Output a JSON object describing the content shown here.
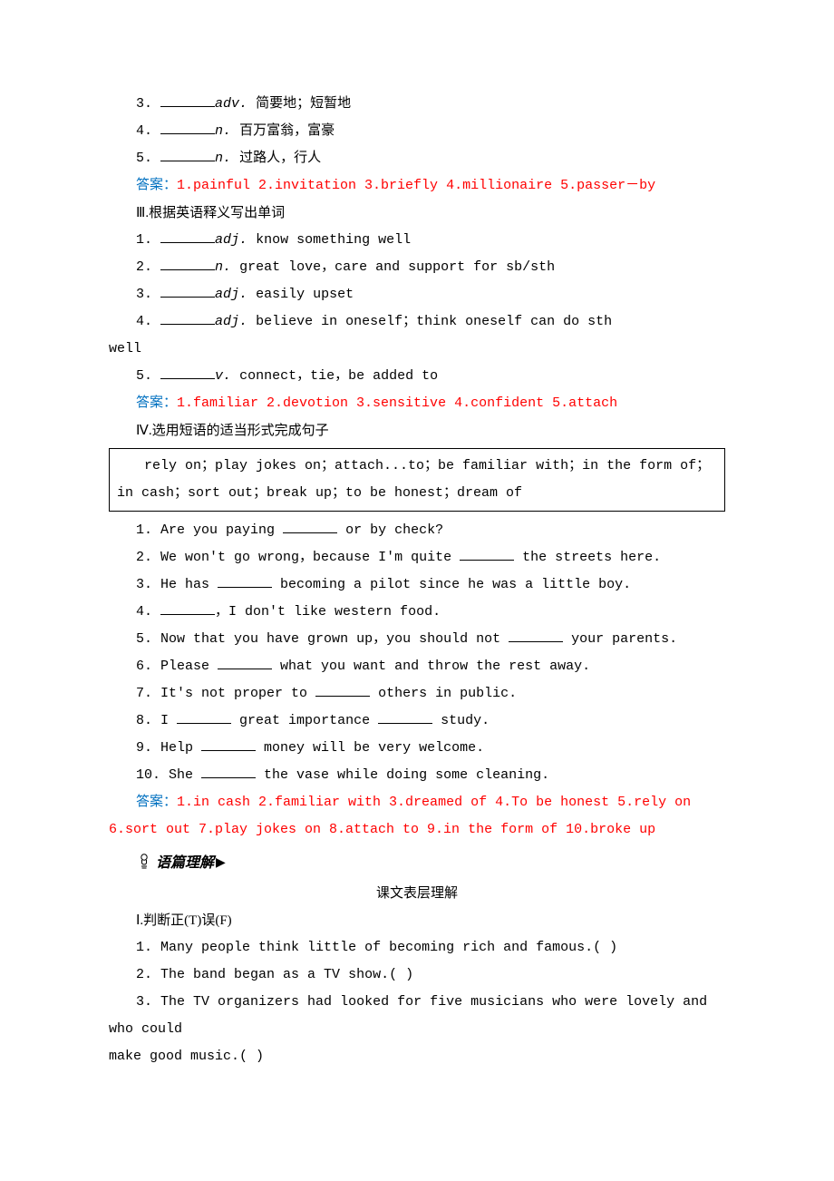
{
  "sec2": {
    "items": [
      {
        "num": "3.",
        "pos": "adv.",
        "def": "简要地；短暂地"
      },
      {
        "num": "4.",
        "pos": "n.",
        "def": "百万富翁，富豪"
      },
      {
        "num": "5.",
        "pos": "n.",
        "def": "过路人，行人"
      }
    ],
    "answer_label": "答案：",
    "answer": "1.painful  2.invitation  3.briefly  4.millionaire  5.passer－by"
  },
  "sec3": {
    "heading": "Ⅲ.根据英语释义写出单词",
    "items": [
      {
        "num": "1.",
        "pos": "adj.",
        "def": "know something well"
      },
      {
        "num": "2.",
        "pos": "n.",
        "def": "great love，care and support for sb/sth"
      },
      {
        "num": "3.",
        "pos": "adj.",
        "def": "easily upset"
      },
      {
        "num": "4.",
        "pos": "adj.",
        "def": "believe in oneself；think oneself can do sth"
      },
      {
        "num": "5.",
        "pos": "v.",
        "def": "connect，tie，be added to"
      }
    ],
    "item4_cont": "well",
    "answer_label": "答案：",
    "answer": "1.familiar  2.devotion  3.sensitive  4.confident  5.attach"
  },
  "sec4": {
    "heading": "Ⅳ.选用短语的适当形式完成句子",
    "box": "rely on；play jokes on；attach...to；be familiar with；in the form of；in cash；sort out；break up；to be honest；dream of",
    "items": [
      {
        "num": "1.",
        "pre": "Are you paying ",
        "post": " or by check?"
      },
      {
        "num": "2.",
        "pre": "We won't go wrong，because I'm quite ",
        "post": " the streets here."
      },
      {
        "num": "3.",
        "pre": "He has ",
        "post": " becoming a pilot since he was a little boy."
      },
      {
        "num": "4.",
        "pre": "",
        "post": "，I don't like western food."
      },
      {
        "num": "5.",
        "pre": "Now that you have grown up，you should not ",
        "post": " your parents."
      },
      {
        "num": "6.",
        "pre": "Please ",
        "post": " what you want and throw the rest away."
      },
      {
        "num": "7.",
        "pre": "It's not proper to ",
        "post": " others in public."
      },
      {
        "num": "8.",
        "pre": "I ",
        "mid": " great importance ",
        "post": " study."
      },
      {
        "num": "9.",
        "pre": "Help ",
        "post": " money will be very welcome."
      },
      {
        "num": "10.",
        "pre": "She ",
        "post": " the vase while doing some cleaning."
      }
    ],
    "answer_label": "答案：",
    "answer_line1": "1.in cash  2.familiar with  3.dreamed of  4.To be honest  5.rely on",
    "answer_line2": "6.sort out  7.play jokes on  8.attach  to  9.in the form of  10.broke up"
  },
  "reading": {
    "heading": "语篇理解",
    "arrow": "▶",
    "subtitle": "课文表层理解",
    "tf_heading": "Ⅰ.判断正(T)误(F)",
    "items": [
      {
        "num": "1.",
        "text": "Many people think little of becoming rich and famous.(    )"
      },
      {
        "num": "2.",
        "text": "The band began as a TV show.(    )"
      },
      {
        "num": "3.",
        "text": "The TV organizers had looked for five musicians who were lovely and who could"
      }
    ],
    "item3_cont": "make good music.(    )"
  }
}
